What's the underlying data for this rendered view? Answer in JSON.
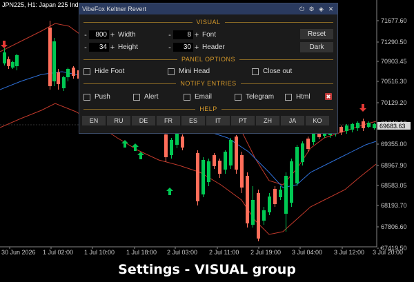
{
  "chart": {
    "symbol_label": "JPN225, H1:  Japan 225 Ind",
    "price_ticks": [
      "71677.60",
      "71290.50",
      "70903.45",
      "70516.30",
      "70129.20",
      "69742.10",
      "69355.00",
      "68967.90",
      "68583.05",
      "68193.70",
      "67806.60",
      "67419.50"
    ],
    "current_price": "69683.63",
    "time_ticks": [
      "30 Jun 2026",
      "1 Jul 02:00",
      "1 Jul 10:00",
      "1 Jul 18:00",
      "2 Jul 03:00",
      "2 Jul 11:00",
      "2 Jul 19:00",
      "3 Jul 04:00",
      "3 Jul 12:00",
      "3 Jul 20:00"
    ],
    "colors": {
      "bull": "#00c853",
      "bear": "#ff6e5a",
      "band": "#c0392b",
      "mid": "#2e6fd6",
      "grid": "#555555"
    }
  },
  "panel": {
    "title": "VibeFox Keltner Revert",
    "icons": [
      "power-icon",
      "gear-icon",
      "move-icon",
      "close-icon"
    ],
    "sections": {
      "visual": "VISUAL",
      "panel_options": "PANEL OPTIONS",
      "notify": "NOTIFY ENTRIES",
      "help": "HELP"
    },
    "visual": {
      "width_value": "800",
      "width_label": "Width",
      "height_value": "34",
      "height_label": "Height",
      "font_value": "8",
      "font_label": "Font",
      "header_value": "30",
      "header_label": "Header",
      "minus": "-",
      "plus": "+",
      "reset_label": "Reset",
      "dark_label": "Dark"
    },
    "panel_options": {
      "hide_foot": "Hide Foot",
      "mini_head": "Mini Head",
      "close_out": "Close out"
    },
    "notify": {
      "push": "Push",
      "alert": "Alert",
      "email": "Email",
      "telegram": "Telegram",
      "html": "Html"
    },
    "languages": [
      "EN",
      "RU",
      "DE",
      "FR",
      "ES",
      "IT",
      "PT",
      "ZH",
      "JA",
      "KO"
    ]
  },
  "caption": "Settings - VISUAL group"
}
